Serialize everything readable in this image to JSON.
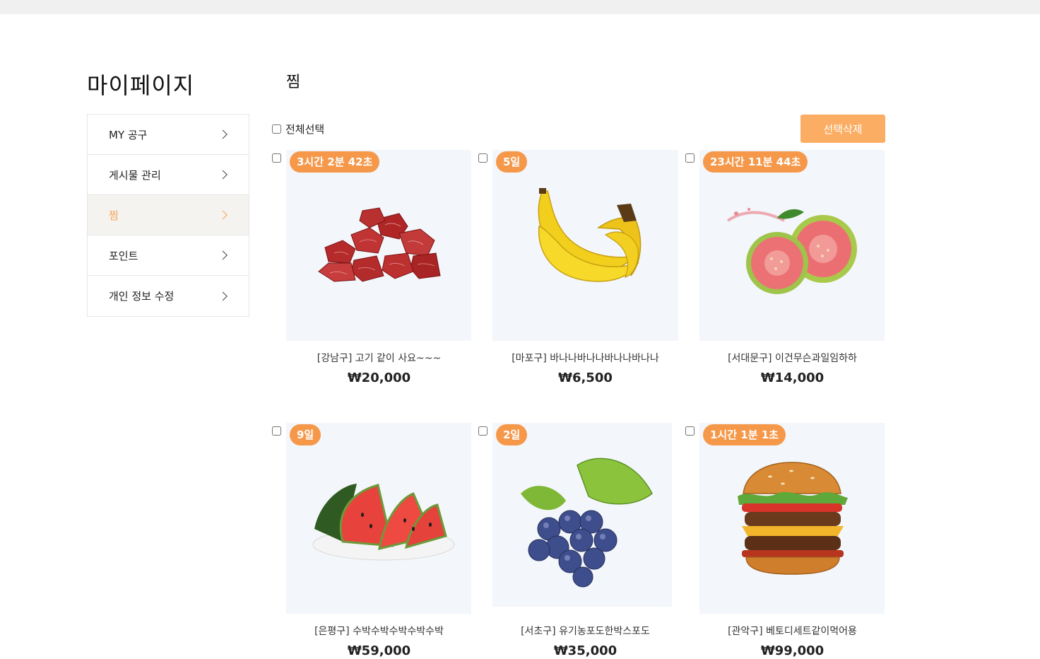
{
  "sidebar": {
    "title": "마이페이지",
    "items": [
      {
        "label": "MY 공구"
      },
      {
        "label": "게시물 관리"
      },
      {
        "label": "찜"
      },
      {
        "label": "포인트"
      },
      {
        "label": "개인 정보 수정"
      }
    ],
    "active_index": 2
  },
  "main": {
    "title": "찜",
    "select_all_label": "전체선택",
    "delete_button_label": "선택삭제"
  },
  "products": [
    {
      "badge": "3시간 2분 42초",
      "name": "[강남구] 고기 같이 사요~~~",
      "price": "₩20,000",
      "icon": "beef-cubes-image"
    },
    {
      "badge": "5일",
      "name": "[마포구] 바나나바나나바나나바나나",
      "price": "₩6,500",
      "icon": "banana-image"
    },
    {
      "badge": "23시간 11분 44초",
      "name": "[서대문구] 이건무슨과일임하하",
      "price": "₩14,000",
      "icon": "guava-image"
    },
    {
      "badge": "9일",
      "name": "[은평구] 수박수박수박수박수박",
      "price": "₩59,000",
      "icon": "watermelon-image"
    },
    {
      "badge": "2일",
      "name": "[서초구] 유기농포도한박스포도",
      "price": "₩35,000",
      "icon": "grapes-image"
    },
    {
      "badge": "1시간 1분 1초",
      "name": "[관악구] 베토디세트같이먹어용",
      "price": "₩99,000",
      "icon": "burger-image"
    }
  ],
  "colors": {
    "accent": "#f6984a",
    "button": "#fbad63",
    "active_bg": "#f5f3ef",
    "thumb_bg": "#f3f6fa"
  }
}
